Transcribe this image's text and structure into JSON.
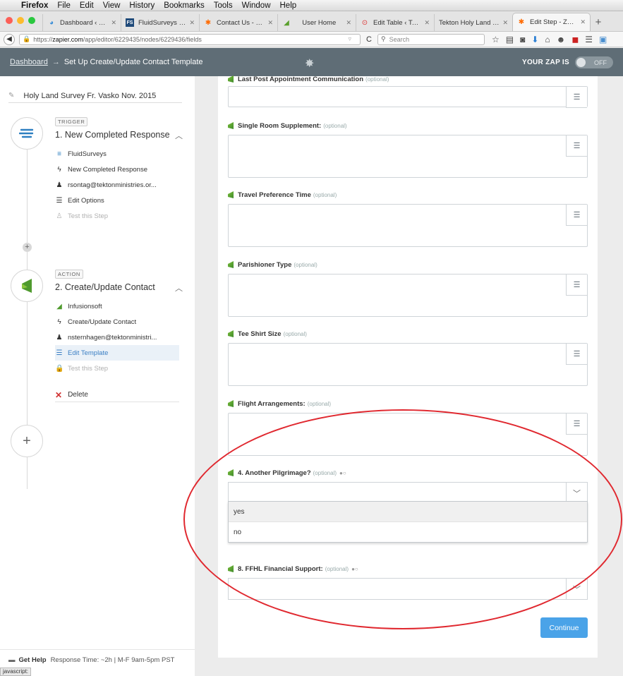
{
  "menubar": {
    "app": "Firefox",
    "items": [
      "File",
      "Edit",
      "View",
      "History",
      "Bookmarks",
      "Tools",
      "Window",
      "Help"
    ]
  },
  "tabs": [
    {
      "label": "Dashboard ‹ Man…",
      "icon": "globe-icon"
    },
    {
      "label": "FluidSurveys - On…",
      "icon": "fs-icon"
    },
    {
      "label": "Contact Us - Zapier",
      "icon": "zapier-icon"
    },
    {
      "label": "User Home",
      "icon": "infusionsoft-icon"
    },
    {
      "label": "Edit Table ‹ Table…",
      "icon": "record-icon"
    },
    {
      "label": "Tekton Holy Land Sur…",
      "icon": "page-icon"
    },
    {
      "label": "Edit Step - Zapier",
      "icon": "zapier-icon",
      "active": true
    }
  ],
  "browser": {
    "url_prefix": "https://",
    "url_host": "zapier.com",
    "url_path": "/app/editor/6229435/nodes/6229436/fields",
    "search_placeholder": "Search"
  },
  "topbar": {
    "crumb": "Dashboard",
    "arrow": "→",
    "title": "Set Up Create/Update Contact Template",
    "zap_is": "YOUR ZAP IS",
    "toggle": "OFF"
  },
  "sidebar": {
    "zap_name": "Holy Land Survey Fr. Vasko Nov. 2015",
    "trigger": {
      "label": "TRIGGER",
      "title": "1. New Completed Response",
      "items": [
        {
          "icon": "fluidsurveys-icon",
          "text": "FluidSurveys"
        },
        {
          "icon": "bolt-icon",
          "text": "New Completed Response"
        },
        {
          "icon": "user-icon",
          "text": "rsontag@tektonministries.or..."
        },
        {
          "icon": "list-icon",
          "text": "Edit Options"
        },
        {
          "icon": "flask-icon",
          "text": "Test this Step"
        }
      ]
    },
    "action": {
      "label": "ACTION",
      "title": "2. Create/Update Contact",
      "items": [
        {
          "icon": "infusionsoft-icon",
          "text": "Infusionsoft"
        },
        {
          "icon": "bolt-icon",
          "text": "Create/Update Contact"
        },
        {
          "icon": "user-icon",
          "text": "nsternhagen@tektonministri..."
        },
        {
          "icon": "list-icon",
          "text": "Edit Template"
        },
        {
          "icon": "lock-icon",
          "text": "Test this Step"
        }
      ]
    },
    "delete": "Delete",
    "help": {
      "title": "Get Help",
      "text": "Response Time: ~2h | M-F 9am-5pm PST"
    }
  },
  "fields": [
    {
      "label": "Last Post Appointment Communication",
      "optional": "(optional)"
    },
    {
      "label": "Single Room Supplement:",
      "optional": "(optional)"
    },
    {
      "label": "Travel Preference Time",
      "optional": "(optional)"
    },
    {
      "label": "Parishioner Type",
      "optional": "(optional)"
    },
    {
      "label": "Tee Shirt Size",
      "optional": "(optional)"
    },
    {
      "label": "Flight Arrangements:",
      "optional": "(optional)"
    }
  ],
  "select_fields": [
    {
      "label": "4. Another Pilgrimage?",
      "optional": "(optional)",
      "options": [
        "yes",
        "no"
      ]
    },
    {
      "label": "8. FFHL Financial Support:",
      "optional": "(optional)"
    }
  ],
  "continue": "Continue",
  "status_bar": "javascript:",
  "colors": {
    "topbar": "#5f6d76",
    "accent": "#4aa3e8",
    "annotation": "#e0282f"
  }
}
